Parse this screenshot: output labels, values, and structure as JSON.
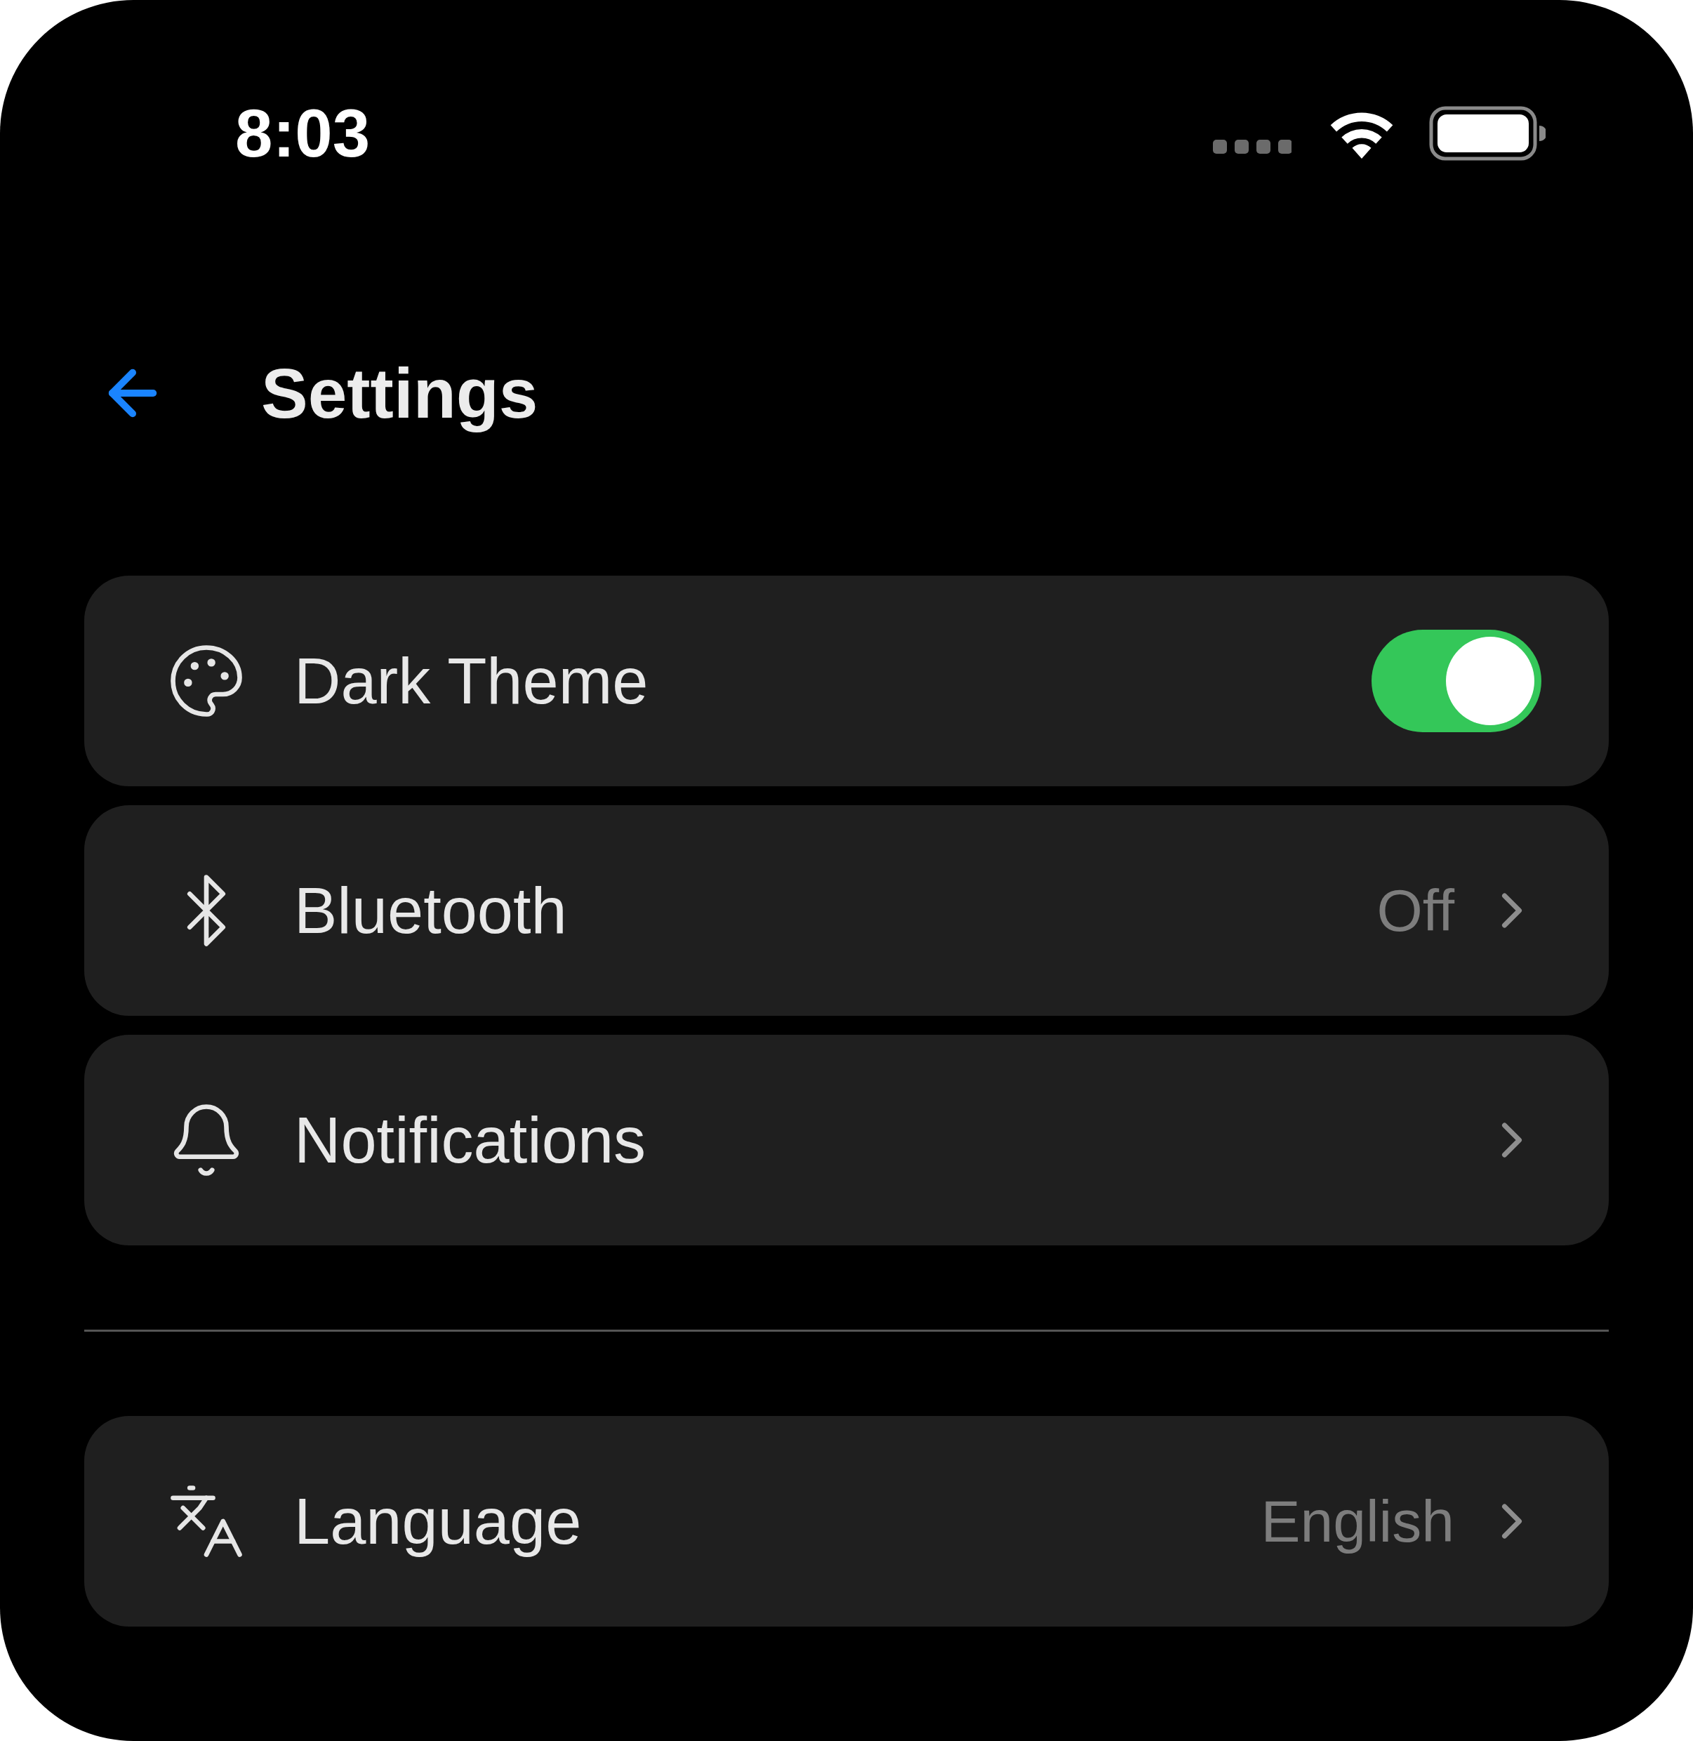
{
  "status_bar": {
    "time": "8:03"
  },
  "header": {
    "title": "Settings"
  },
  "sections": [
    {
      "items": [
        {
          "kind": "toggle",
          "label": "Dark Theme",
          "on": true
        },
        {
          "kind": "link",
          "label": "Bluetooth",
          "value": "Off"
        },
        {
          "kind": "link",
          "label": "Notifications"
        }
      ]
    },
    {
      "items": [
        {
          "kind": "link",
          "label": "Language",
          "value": "English"
        }
      ]
    }
  ]
}
